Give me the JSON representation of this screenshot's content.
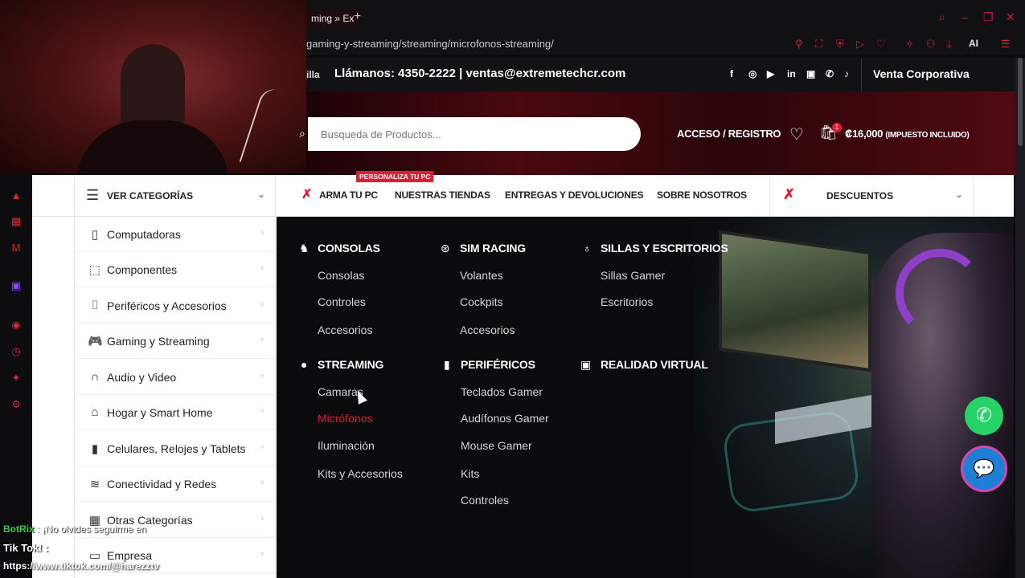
{
  "browser": {
    "tab_title": "ming » Ex",
    "url": "gaming-y-streaming/streaming/microfonos-streaming/",
    "ai_label": "AI"
  },
  "topbar": {
    "city": "illa",
    "contact": "Llámanos: 4350-2222 | ventas@extremetechcr.com",
    "corporate": "Venta Corporativa",
    "social_icons": [
      "facebook-icon",
      "instagram-icon",
      "youtube-icon",
      "linkedin-icon",
      "twitch-icon",
      "whatsapp-icon",
      "tiktok-icon"
    ]
  },
  "header": {
    "search_placeholder": "Busqueda de Productos...",
    "login": "ACCESO / REGISTRO",
    "cart_count": "1",
    "cart_total": "₡16,000",
    "cart_tax": "(IMPUESTO INCLUIDO)"
  },
  "nav": {
    "categories_label": "VER CATEGORÍAS",
    "badge": "PERSONALIZA TU PC",
    "items": [
      "ARMA TU PC",
      "NUESTRAS TIENDAS",
      "ENTREGAS Y DEVOLUCIONES",
      "SOBRE NOSOTROS"
    ],
    "discounts": "DESCUENTOS"
  },
  "categories": [
    {
      "label": "Computadoras",
      "icon": "pc-tower-icon"
    },
    {
      "label": "Componentes",
      "icon": "cpu-chip-icon"
    },
    {
      "label": "Periféricos y Accesorios",
      "icon": "mouse-icon"
    },
    {
      "label": "Gaming y Streaming",
      "icon": "gamepad-icon"
    },
    {
      "label": "Audio y Video",
      "icon": "headphones-icon"
    },
    {
      "label": "Hogar y Smart Home",
      "icon": "house-icon"
    },
    {
      "label": "Celulares, Relojes y Tablets",
      "icon": "phone-icon"
    },
    {
      "label": "Conectividad y Redes",
      "icon": "wifi-icon"
    },
    {
      "label": "Otras Categorías",
      "icon": "grid-icon"
    },
    {
      "label": "Empresa",
      "icon": "briefcase-icon"
    }
  ],
  "mega": {
    "consolas": {
      "title": "CONSOLAS",
      "links": [
        "Consolas",
        "Controles",
        "Accesorios"
      ]
    },
    "sim_racing": {
      "title": "SIM RACING",
      "links": [
        "Volantes",
        "Cockpits",
        "Accesorios"
      ]
    },
    "sillas": {
      "title": "SILLAS Y ESCRITORIOS",
      "links": [
        "Sillas Gamer",
        "Escritorios"
      ]
    },
    "streaming": {
      "title": "STREAMING",
      "links": [
        "Camaras",
        "Micrófonos",
        "Iluminación",
        "Kits y Accesorios"
      ],
      "active_index": 1
    },
    "perifericos": {
      "title": "PERIFÉRICOS",
      "links": [
        "Teclados Gamer",
        "Audífonos Gamer",
        "Mouse Gamer",
        "Kits",
        "Controles"
      ]
    },
    "vr": {
      "title": "REALIDAD VIRTUAL",
      "links": []
    }
  },
  "stream_chat": {
    "bot_name": "BotRix",
    "line1": ": ¡No olvides seguirme en",
    "line2": "Tik Tok! :",
    "line3": "https://www.tiktok.com/@harezztv"
  },
  "colors": {
    "accent": "#e21c35",
    "whatsapp": "#25d366",
    "chat": "#1e7fd6"
  }
}
